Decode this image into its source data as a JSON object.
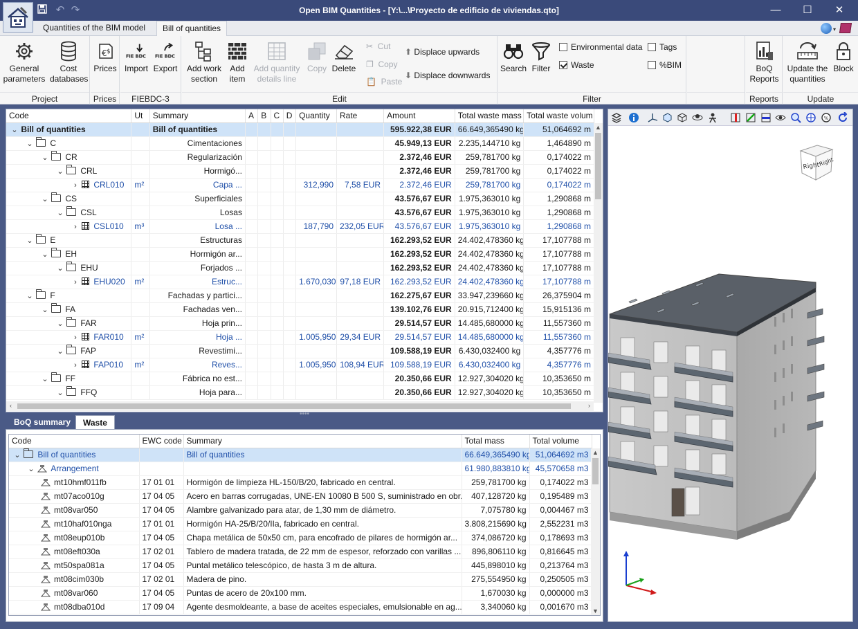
{
  "window": {
    "title": "Open BIM Quantities - [Y:\\...\\Proyecto de edificio de viviendas.qto]"
  },
  "ribbon_tabs": [
    {
      "label": "Quantities of the BIM model"
    },
    {
      "label": "Bill of quantities"
    }
  ],
  "groups": {
    "project": {
      "label": "Project",
      "general": "General parameters",
      "cost": "Cost databases"
    },
    "prices": {
      "label": "Prices",
      "prices": "Prices"
    },
    "fiebdc": {
      "label": "FIEBDC-3",
      "import": "Import",
      "export": "Export",
      "fie_text": "FIE BDC"
    },
    "edit": {
      "label": "Edit",
      "add_work": "Add work section",
      "add_item": "Add item",
      "add_qty": "Add quantity details line",
      "copy": "Copy",
      "delete": "Delete",
      "cut_small": "Cut",
      "copy_small": "Copy",
      "paste_small": "Paste",
      "up": "Displace upwards",
      "down": "Displace downwards"
    },
    "filter": {
      "label": "Filter",
      "search": "Search",
      "filter": "Filter",
      "env": "Environmental data",
      "waste": "Waste",
      "tags": "Tags",
      "bim": "%BIM"
    },
    "reports": {
      "label": "Reports",
      "boq": "BoQ Reports"
    },
    "update": {
      "label": "Update",
      "update_q": "Update the quantities",
      "block": "Block"
    }
  },
  "filter_checks": {
    "env": false,
    "waste": true,
    "tags": false,
    "bim": false
  },
  "tree": {
    "columns": [
      "Code",
      "Ut",
      "Summary",
      "A",
      "B",
      "C",
      "D",
      "Quantity",
      "Rate",
      "Amount",
      "Total waste mass",
      "Total waste volum"
    ],
    "rows": [
      {
        "level": 0,
        "kind": "root",
        "exp": "open",
        "code": "Bill of quantities",
        "ut": "",
        "summary": "Bill of quantities",
        "qty": "",
        "rate": "",
        "amount": "595.922,38 EUR",
        "mass": "66.649,365490 kg",
        "vol": "51,064692 m",
        "sel": true
      },
      {
        "level": 1,
        "kind": "folder",
        "exp": "open",
        "code": "C",
        "ut": "",
        "summary": "Cimentaciones",
        "qty": "",
        "rate": "",
        "amount": "45.949,13 EUR",
        "mass": "2.235,144710 kg",
        "vol": "1,464890 m"
      },
      {
        "level": 2,
        "kind": "folder",
        "exp": "open",
        "code": "CR",
        "ut": "",
        "summary": "Regularización",
        "qty": "",
        "rate": "",
        "amount": "2.372,46 EUR",
        "mass": "259,781700 kg",
        "vol": "0,174022 m"
      },
      {
        "level": 3,
        "kind": "folder",
        "exp": "open",
        "code": "CRL",
        "ut": "",
        "summary": "Hormigó...",
        "qty": "",
        "rate": "",
        "amount": "2.372,46 EUR",
        "mass": "259,781700 kg",
        "vol": "0,174022 m"
      },
      {
        "level": 4,
        "kind": "item",
        "exp": "closed",
        "code": "CRL010",
        "ut": "m²",
        "summary": "Capa ...",
        "qty": "312,990",
        "rate": "7,58 EUR",
        "amount": "2.372,46 EUR",
        "mass": "259,781700 kg",
        "vol": "0,174022 m"
      },
      {
        "level": 2,
        "kind": "folder",
        "exp": "open",
        "code": "CS",
        "ut": "",
        "summary": "Superficiales",
        "qty": "",
        "rate": "",
        "amount": "43.576,67 EUR",
        "mass": "1.975,363010 kg",
        "vol": "1,290868 m"
      },
      {
        "level": 3,
        "kind": "folder",
        "exp": "open",
        "code": "CSL",
        "ut": "",
        "summary": "Losas",
        "qty": "",
        "rate": "",
        "amount": "43.576,67 EUR",
        "mass": "1.975,363010 kg",
        "vol": "1,290868 m"
      },
      {
        "level": 4,
        "kind": "item",
        "exp": "closed",
        "code": "CSL010",
        "ut": "m³",
        "summary": "Losa ...",
        "qty": "187,790",
        "rate": "232,05 EUR",
        "amount": "43.576,67 EUR",
        "mass": "1.975,363010 kg",
        "vol": "1,290868 m"
      },
      {
        "level": 1,
        "kind": "folder",
        "exp": "open",
        "code": "E",
        "ut": "",
        "summary": "Estructuras",
        "qty": "",
        "rate": "",
        "amount": "162.293,52 EUR",
        "mass": "24.402,478360 kg",
        "vol": "17,107788 m"
      },
      {
        "level": 2,
        "kind": "folder",
        "exp": "open",
        "code": "EH",
        "ut": "",
        "summary": "Hormigón ar...",
        "qty": "",
        "rate": "",
        "amount": "162.293,52 EUR",
        "mass": "24.402,478360 kg",
        "vol": "17,107788 m"
      },
      {
        "level": 3,
        "kind": "folder",
        "exp": "open",
        "code": "EHU",
        "ut": "",
        "summary": "Forjados ...",
        "qty": "",
        "rate": "",
        "amount": "162.293,52 EUR",
        "mass": "24.402,478360 kg",
        "vol": "17,107788 m"
      },
      {
        "level": 4,
        "kind": "item",
        "exp": "closed",
        "code": "EHU020",
        "ut": "m²",
        "summary": "Estruc...",
        "qty": "1.670,030",
        "rate": "97,18 EUR",
        "amount": "162.293,52 EUR",
        "mass": "24.402,478360 kg",
        "vol": "17,107788 m"
      },
      {
        "level": 1,
        "kind": "folder",
        "exp": "open",
        "code": "F",
        "ut": "",
        "summary": "Fachadas y partici...",
        "qty": "",
        "rate": "",
        "amount": "162.275,67 EUR",
        "mass": "33.947,239660 kg",
        "vol": "26,375904 m"
      },
      {
        "level": 2,
        "kind": "folder",
        "exp": "open",
        "code": "FA",
        "ut": "",
        "summary": "Fachadas ven...",
        "qty": "",
        "rate": "",
        "amount": "139.102,76 EUR",
        "mass": "20.915,712400 kg",
        "vol": "15,915136 m"
      },
      {
        "level": 3,
        "kind": "folder",
        "exp": "open",
        "code": "FAR",
        "ut": "",
        "summary": "Hoja prin...",
        "qty": "",
        "rate": "",
        "amount": "29.514,57 EUR",
        "mass": "14.485,680000 kg",
        "vol": "11,557360 m"
      },
      {
        "level": 4,
        "kind": "item",
        "exp": "closed",
        "code": "FAR010",
        "ut": "m²",
        "summary": "Hoja ...",
        "qty": "1.005,950",
        "rate": "29,34 EUR",
        "amount": "29.514,57 EUR",
        "mass": "14.485,680000 kg",
        "vol": "11,557360 m"
      },
      {
        "level": 3,
        "kind": "folder",
        "exp": "open",
        "code": "FAP",
        "ut": "",
        "summary": "Revestimi...",
        "qty": "",
        "rate": "",
        "amount": "109.588,19 EUR",
        "mass": "6.430,032400 kg",
        "vol": "4,357776 m"
      },
      {
        "level": 4,
        "kind": "item",
        "exp": "closed",
        "code": "FAP010",
        "ut": "m²",
        "summary": "Reves...",
        "qty": "1.005,950",
        "rate": "108,94 EUR",
        "amount": "109.588,19 EUR",
        "mass": "6.430,032400 kg",
        "vol": "4,357776 m"
      },
      {
        "level": 2,
        "kind": "folder",
        "exp": "open",
        "code": "FF",
        "ut": "",
        "summary": "Fábrica no est...",
        "qty": "",
        "rate": "",
        "amount": "20.350,66 EUR",
        "mass": "12.927,304020 kg",
        "vol": "10,353650 m"
      },
      {
        "level": 3,
        "kind": "folder",
        "exp": "open",
        "code": "FFQ",
        "ut": "",
        "summary": "Hoja para...",
        "qty": "",
        "rate": "",
        "amount": "20.350,66 EUR",
        "mass": "12.927,304020 kg",
        "vol": "10,353650 m"
      }
    ]
  },
  "bottom_tabs": [
    {
      "label": "BoQ summary"
    },
    {
      "label": "Waste"
    }
  ],
  "waste": {
    "columns": [
      "Code",
      "EWC code",
      "Summary",
      "Total mass",
      "Total volume"
    ],
    "rows": [
      {
        "level": 0,
        "kind": "root",
        "code": "Bill of quantities",
        "ewc": "",
        "summary": "Bill of quantities",
        "mass": "66.649,365490 kg",
        "vol": "51,064692 m3",
        "sel": true
      },
      {
        "level": 1,
        "kind": "group",
        "code": "Arrangement",
        "ewc": "",
        "summary": "",
        "mass": "61.980,883810 kg",
        "vol": "45,570658 m3"
      },
      {
        "level": 2,
        "kind": "leaf",
        "code": "mt10hmf011fb",
        "ewc": "17 01 01",
        "summary": "Hormigón de limpieza HL-150/B/20, fabricado en central.",
        "mass": "259,781700 kg",
        "vol": "0,174022 m3"
      },
      {
        "level": 2,
        "kind": "leaf",
        "code": "mt07aco010g",
        "ewc": "17 04 05",
        "summary": "Acero en barras corrugadas, UNE-EN 10080 B 500 S, suministrado en obr...",
        "mass": "407,128720 kg",
        "vol": "0,195489 m3"
      },
      {
        "level": 2,
        "kind": "leaf",
        "code": "mt08var050",
        "ewc": "17 04 05",
        "summary": "Alambre galvanizado para atar, de 1,30 mm de diámetro.",
        "mass": "7,075780 kg",
        "vol": "0,004467 m3"
      },
      {
        "level": 2,
        "kind": "leaf",
        "code": "mt10haf010nga",
        "ewc": "17 01 01",
        "summary": "Hormigón HA-25/B/20/IIa, fabricado en central.",
        "mass": "3.808,215690 kg",
        "vol": "2,552231 m3"
      },
      {
        "level": 2,
        "kind": "leaf",
        "code": "mt08eup010b",
        "ewc": "17 04 05",
        "summary": "Chapa metálica de 50x50 cm, para encofrado de pilares de hormigón ar...",
        "mass": "374,086720 kg",
        "vol": "0,178693 m3"
      },
      {
        "level": 2,
        "kind": "leaf",
        "code": "mt08eft030a",
        "ewc": "17 02 01",
        "summary": "Tablero de madera tratada, de 22 mm de espesor, reforzado con varillas ...",
        "mass": "896,806110 kg",
        "vol": "0,816645 m3"
      },
      {
        "level": 2,
        "kind": "leaf",
        "code": "mt50spa081a",
        "ewc": "17 04 05",
        "summary": "Puntal metálico telescópico, de hasta 3 m de altura.",
        "mass": "445,898010 kg",
        "vol": "0,213764 m3"
      },
      {
        "level": 2,
        "kind": "leaf",
        "code": "mt08cim030b",
        "ewc": "17 02 01",
        "summary": "Madera de pino.",
        "mass": "275,554950 kg",
        "vol": "0,250505 m3"
      },
      {
        "level": 2,
        "kind": "leaf",
        "code": "mt08var060",
        "ewc": "17 04 05",
        "summary": "Puntas de acero de 20x100 mm.",
        "mass": "1,670030 kg",
        "vol": "0,000000 m3"
      },
      {
        "level": 2,
        "kind": "leaf",
        "code": "mt08dba010d",
        "ewc": "17 09 04",
        "summary": "Agente desmoldeante, a base de aceites especiales, emulsionable en ag...",
        "mass": "3,340060 kg",
        "vol": "0,001670 m3"
      }
    ]
  },
  "viewer": {
    "navcube": {
      "top": "",
      "front": "Right",
      "side": "Right"
    }
  },
  "colors": {
    "titlebar": "#3a4a7a",
    "selection": "#cfe3f8",
    "link_blue": "#1f4fa8",
    "frame": "#4a5a86"
  }
}
